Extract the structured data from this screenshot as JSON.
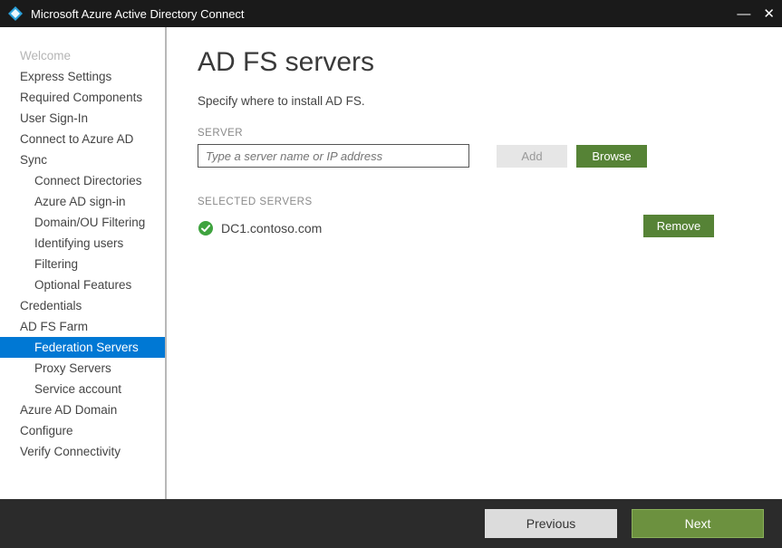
{
  "titlebar": {
    "title": "Microsoft Azure Active Directory Connect"
  },
  "sidebar": {
    "items": [
      {
        "label": "Welcome",
        "state": "disabled",
        "sub": false
      },
      {
        "label": "Express Settings",
        "state": "normal",
        "sub": false
      },
      {
        "label": "Required Components",
        "state": "normal",
        "sub": false
      },
      {
        "label": "User Sign-In",
        "state": "normal",
        "sub": false
      },
      {
        "label": "Connect to Azure AD",
        "state": "normal",
        "sub": false
      },
      {
        "label": "Sync",
        "state": "normal",
        "sub": false
      },
      {
        "label": "Connect Directories",
        "state": "normal",
        "sub": true
      },
      {
        "label": "Azure AD sign-in",
        "state": "normal",
        "sub": true
      },
      {
        "label": "Domain/OU Filtering",
        "state": "normal",
        "sub": true
      },
      {
        "label": "Identifying users",
        "state": "normal",
        "sub": true
      },
      {
        "label": "Filtering",
        "state": "normal",
        "sub": true
      },
      {
        "label": "Optional Features",
        "state": "normal",
        "sub": true
      },
      {
        "label": "Credentials",
        "state": "normal",
        "sub": false
      },
      {
        "label": "AD FS Farm",
        "state": "normal",
        "sub": false
      },
      {
        "label": "Federation Servers",
        "state": "active",
        "sub": true
      },
      {
        "label": "Proxy Servers",
        "state": "normal",
        "sub": true
      },
      {
        "label": "Service account",
        "state": "normal",
        "sub": true
      },
      {
        "label": "Azure AD Domain",
        "state": "normal",
        "sub": false
      },
      {
        "label": "Configure",
        "state": "normal",
        "sub": false
      },
      {
        "label": "Verify Connectivity",
        "state": "normal",
        "sub": false
      }
    ]
  },
  "content": {
    "title": "AD FS servers",
    "subtitle": "Specify where to install AD FS.",
    "server_label": "SERVER",
    "server_placeholder": "Type a server name or IP address",
    "add_label": "Add",
    "browse_label": "Browse",
    "selected_label": "SELECTED SERVERS",
    "selected_server": "DC1.contoso.com",
    "remove_label": "Remove"
  },
  "footer": {
    "previous": "Previous",
    "next": "Next"
  }
}
